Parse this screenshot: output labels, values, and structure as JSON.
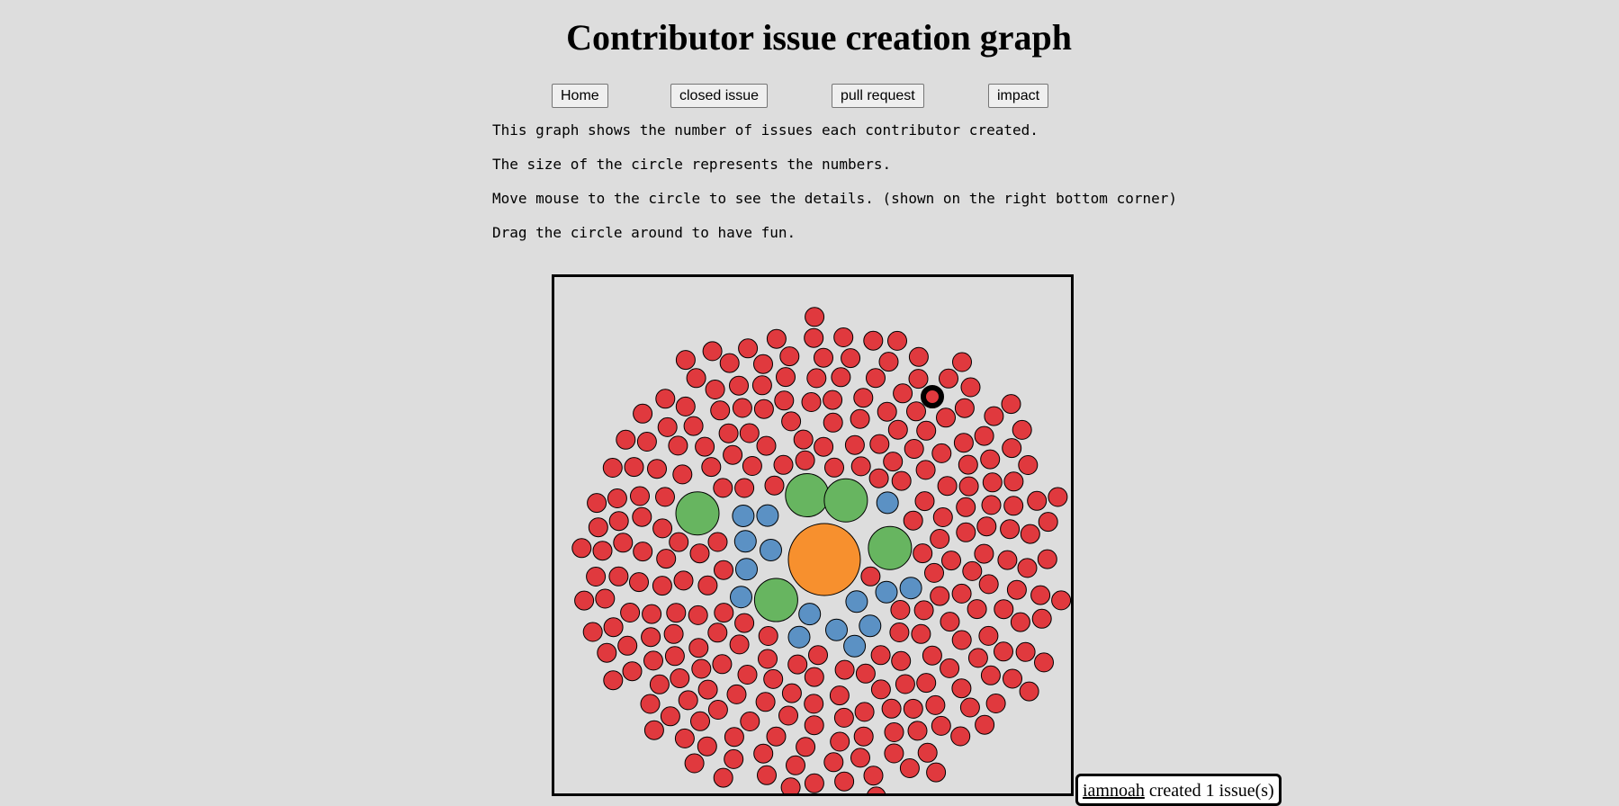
{
  "page": {
    "title": "Contributor issue creation graph"
  },
  "nav": {
    "home_label": "Home",
    "closed_issue_label": "closed issue",
    "pull_request_label": "pull request",
    "impact_label": "impact"
  },
  "description": {
    "line1": "This graph shows the number of issues each contributor created.",
    "line2": "The size of the circle represents the numbers.",
    "line3": "Move mouse to the circle to see the details. (shown on the right bottom corner)",
    "line4": "Drag the circle around to have fun."
  },
  "tooltip": {
    "user": "iamnoah",
    "text": " created 1 issue(s)"
  },
  "chart_data": {
    "type": "bubble",
    "title": "",
    "xlabel": "",
    "ylabel": "",
    "grid": false,
    "legend": "none",
    "colors": {
      "red": "#e0393e",
      "blue": "#5b91c4",
      "green": "#67b560",
      "orange": "#f7902e",
      "highlight_ring": "#000000"
    },
    "counts": {
      "red": 258,
      "blue": 15,
      "green": 5,
      "orange": 1
    },
    "highlighted": {
      "user": "iamnoah",
      "issues": 1
    }
  }
}
